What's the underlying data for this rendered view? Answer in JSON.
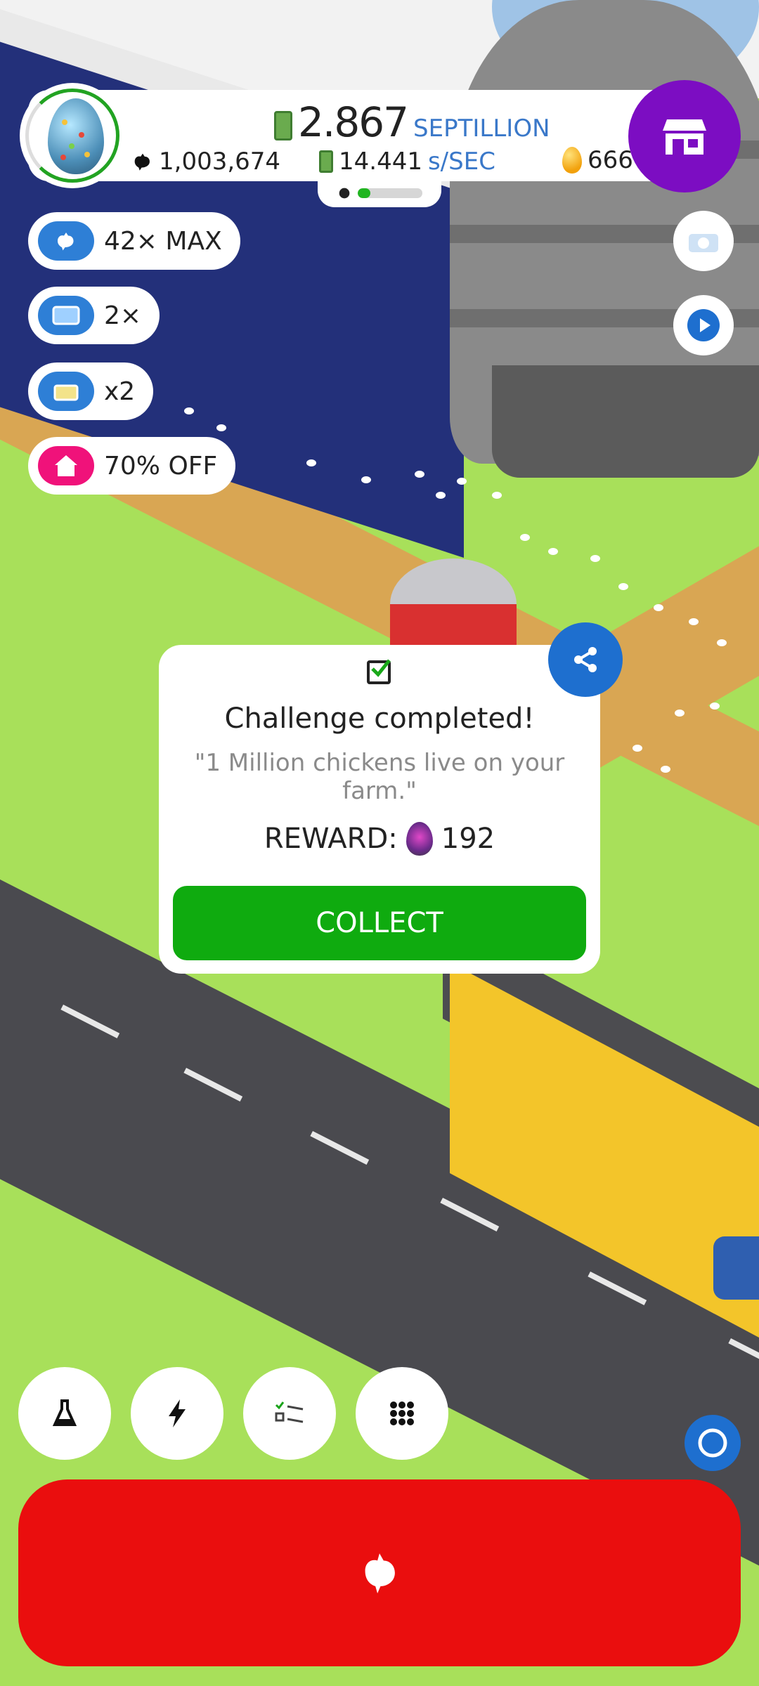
{
  "colors": {
    "grass": "#a8e05a",
    "shop_purple": "#7c0dc2",
    "collect_green": "#0fab0f",
    "hatch_red": "#ea0e0e",
    "accent_blue": "#3a78c9",
    "share_blue": "#1e6fcf"
  },
  "hud": {
    "money_value": "2.867",
    "money_unit": "SEPTILLION",
    "chicken_count": "1,003,674",
    "earn_rate_value": "14.441",
    "earn_rate_unit": "s/SEC",
    "golden_eggs": "666",
    "hatch_progress": 0.2
  },
  "boosts": [
    {
      "label": "42× MAX",
      "icon": "chicken-icon",
      "color": "#2e7fd6"
    },
    {
      "label": "2×",
      "icon": "tv-icon",
      "color": "#2e7fd6"
    },
    {
      "label": "x2",
      "icon": "gift-icon",
      "color": "#2e7fd6"
    },
    {
      "label": "70% OFF",
      "icon": "house-icon",
      "color": "#f0127a"
    }
  ],
  "dialog": {
    "title": "Challenge completed!",
    "subtitle": "\"1 Million chickens live on your farm.\"",
    "reward_label": "REWARD:",
    "reward_value": "192",
    "collect_label": "COLLECT"
  },
  "toolbar": {
    "items": [
      "research-flask-icon",
      "boost-lightning-icon",
      "challenges-list-icon",
      "menu-grid-icon"
    ]
  }
}
